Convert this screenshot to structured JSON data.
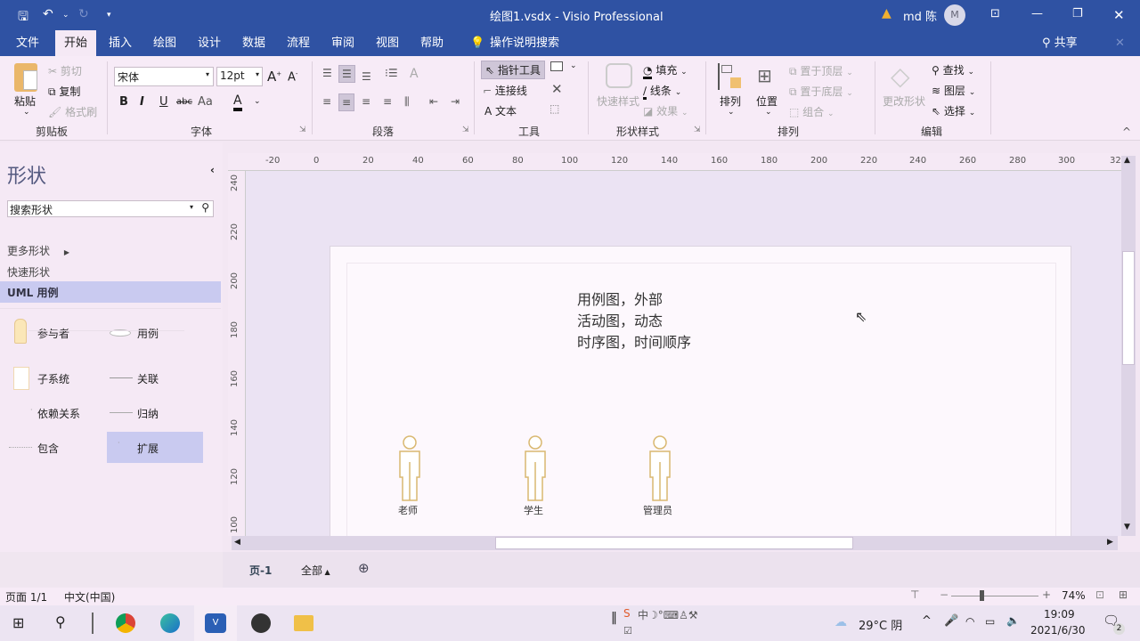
{
  "titlebar": {
    "title": "绘图1.vsdx  -  Visio Professional",
    "user": "md 陈",
    "avatar_initial": "M",
    "icons": [
      "save-icon",
      "undo-icon",
      "redo-icon",
      "customize-icon",
      "warning-icon",
      "ribbon-display-icon",
      "minimize-icon",
      "restore-icon",
      "close-icon"
    ]
  },
  "menu": {
    "tabs": [
      "文件",
      "开始",
      "插入",
      "绘图",
      "设计",
      "数据",
      "流程",
      "审阅",
      "视图",
      "帮助"
    ],
    "active": "开始",
    "search": "操作说明搜索",
    "share": "共享"
  },
  "ribbon": {
    "clipboard": {
      "paste": "粘贴",
      "cut": "剪切",
      "copy": "复制",
      "format_painter": "格式刷",
      "label": "剪贴板"
    },
    "font": {
      "name": "宋体",
      "size": "12pt",
      "bold": "B",
      "italic": "I",
      "underline": "U",
      "strike": "abc",
      "case": "Aa",
      "label": "字体"
    },
    "paragraph": {
      "label": "段落"
    },
    "tools": {
      "pointer": "指针工具",
      "connector": "连接线",
      "text": "文本",
      "label": "工具"
    },
    "shape_style": {
      "quick": "快速样式",
      "fill": "填充",
      "line": "线条",
      "effect": "效果",
      "label": "形状样式"
    },
    "arrange": {
      "arrange": "排列",
      "position": "位置",
      "bring_front": "置于顶层",
      "send_back": "置于底层",
      "group": "组合",
      "label": "排列"
    },
    "edit": {
      "change_shape": "更改形状",
      "find": "查找",
      "layers": "图层",
      "select": "选择",
      "label": "编辑"
    }
  },
  "shapes_pane": {
    "title": "形状",
    "search_placeholder": "搜索形状",
    "more": "更多形状",
    "quick": "快速形状",
    "stencil": "UML 用例",
    "items": [
      {
        "label": "参与者",
        "icon": "actor-icon"
      },
      {
        "label": "用例",
        "icon": "ellipse-icon"
      },
      {
        "label": "子系统",
        "icon": "rectangle-icon"
      },
      {
        "label": "关联",
        "icon": "line-icon"
      },
      {
        "label": "依赖关系",
        "icon": "dashed-arrow-icon"
      },
      {
        "label": "归纳",
        "icon": "arrow-icon"
      },
      {
        "label": "包含",
        "icon": "dashed-arrow-icon"
      },
      {
        "label": "扩展",
        "icon": "dashed-arrow-icon",
        "selected": true
      }
    ]
  },
  "rulers": {
    "horizontal": [
      "-20",
      "0",
      "20",
      "40",
      "60",
      "80",
      "100",
      "120",
      "140",
      "160",
      "180",
      "200",
      "220",
      "240",
      "260",
      "280",
      "300",
      "32"
    ],
    "vertical": [
      "240",
      "220",
      "200",
      "180",
      "160",
      "140",
      "120",
      "100"
    ]
  },
  "canvas": {
    "text_lines": [
      "用例图，外部",
      "活动图，动态",
      "时序图，时间顺序"
    ],
    "actors": [
      "老师",
      "学生",
      "管理员"
    ]
  },
  "page_tabs": {
    "current": "页-1",
    "all": "全部"
  },
  "status": {
    "page": "页面 1/1",
    "lang": "中文(中国)",
    "zoom": "74%",
    "zoom_value": 74
  },
  "taskbar": {
    "weather": "29°C 阴",
    "time": "19:09",
    "date": "2021/6/30",
    "notifications": "2"
  }
}
